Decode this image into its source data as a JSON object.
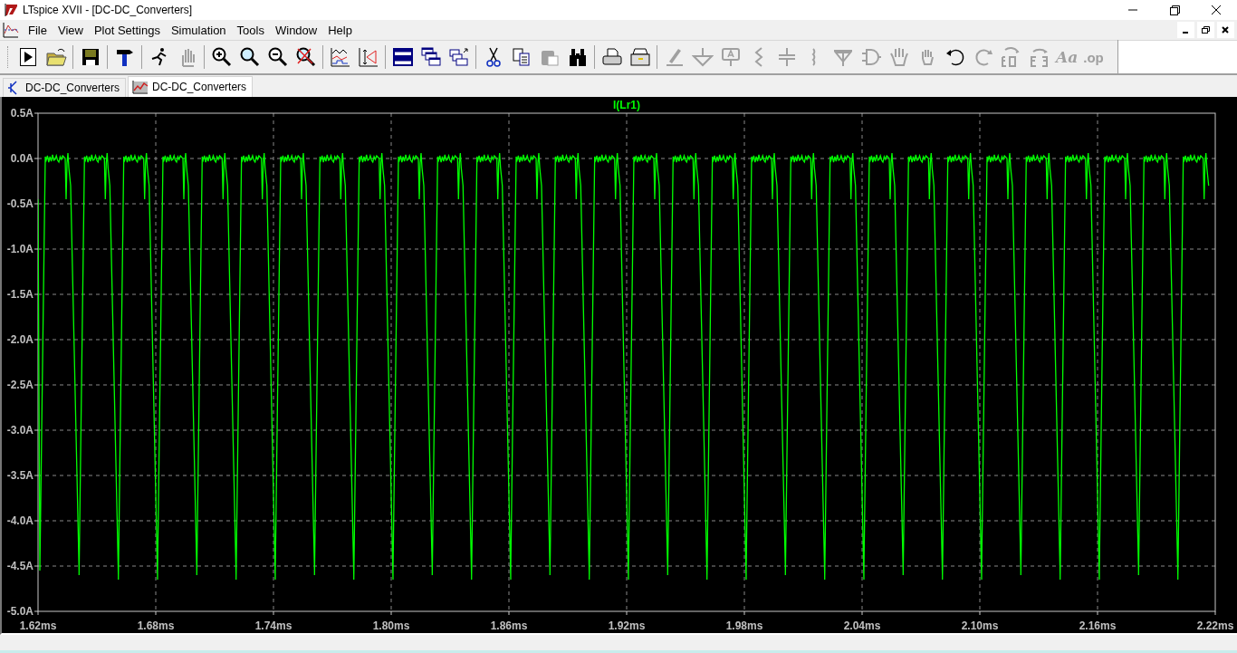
{
  "window": {
    "title": "LTspice XVII - [DC-DC_Converters]"
  },
  "menu": [
    "File",
    "View",
    "Plot Settings",
    "Simulation",
    "Tools",
    "Window",
    "Help"
  ],
  "toolbar": [
    {
      "kind": "run",
      "disabled": false
    },
    {
      "kind": "open",
      "disabled": false
    },
    {
      "kind": "sep"
    },
    {
      "kind": "save",
      "disabled": false
    },
    {
      "kind": "sep"
    },
    {
      "kind": "hammer",
      "disabled": false
    },
    {
      "kind": "sep"
    },
    {
      "kind": "runner",
      "disabled": false
    },
    {
      "kind": "hand",
      "disabled": true
    },
    {
      "kind": "sep"
    },
    {
      "kind": "zoomin",
      "disabled": false
    },
    {
      "kind": "zoom",
      "disabled": false
    },
    {
      "kind": "zoomout",
      "disabled": false
    },
    {
      "kind": "zoomcancel",
      "disabled": false
    },
    {
      "kind": "sep"
    },
    {
      "kind": "wave",
      "disabled": false
    },
    {
      "kind": "autorange",
      "disabled": false
    },
    {
      "kind": "sep"
    },
    {
      "kind": "tile",
      "disabled": false
    },
    {
      "kind": "cascade",
      "disabled": false
    },
    {
      "kind": "arrange",
      "disabled": false
    },
    {
      "kind": "sep"
    },
    {
      "kind": "cut",
      "disabled": false
    },
    {
      "kind": "copy",
      "disabled": false
    },
    {
      "kind": "paste",
      "disabled": true
    },
    {
      "kind": "find",
      "disabled": false
    },
    {
      "kind": "sep"
    },
    {
      "kind": "print",
      "disabled": false
    },
    {
      "kind": "printsetup",
      "disabled": false
    },
    {
      "kind": "sep"
    },
    {
      "kind": "wire",
      "disabled": true
    },
    {
      "kind": "ground",
      "disabled": true
    },
    {
      "kind": "label",
      "disabled": true
    },
    {
      "kind": "resistor",
      "disabled": true
    },
    {
      "kind": "capacitor",
      "disabled": true
    },
    {
      "kind": "inductor",
      "disabled": true
    },
    {
      "kind": "diode",
      "disabled": true
    },
    {
      "kind": "component",
      "disabled": true
    },
    {
      "kind": "drag",
      "disabled": true
    },
    {
      "kind": "move",
      "disabled": true
    },
    {
      "kind": "undo",
      "disabled": false
    },
    {
      "kind": "redo",
      "disabled": true
    },
    {
      "kind": "rotate",
      "disabled": true
    },
    {
      "kind": "mirror",
      "disabled": true
    },
    {
      "kind": "text",
      "disabled": true,
      "label": "Aa"
    },
    {
      "kind": "directive",
      "disabled": true,
      "label": ".op"
    }
  ],
  "tabs": [
    {
      "label": "DC-DC_Converters",
      "kind": "schematic",
      "selected": false
    },
    {
      "label": "DC-DC_Converters",
      "kind": "waveform",
      "selected": true
    }
  ],
  "plot": {
    "trace": "I(Lr1)",
    "color": "#00ff00",
    "yticks": [
      "0.5A",
      "0.0A",
      "-0.5A",
      "-1.0A",
      "-1.5A",
      "-2.0A",
      "-2.5A",
      "-3.0A",
      "-3.5A",
      "-4.0A",
      "-4.5A",
      "-5.0A"
    ],
    "xticks": [
      "1.62ms",
      "1.68ms",
      "1.74ms",
      "1.80ms",
      "1.86ms",
      "1.92ms",
      "1.98ms",
      "2.04ms",
      "2.10ms",
      "2.16ms",
      "2.22ms"
    ]
  }
}
